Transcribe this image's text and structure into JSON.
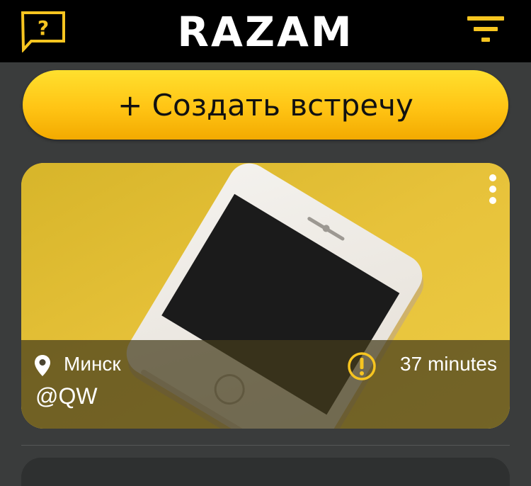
{
  "header": {
    "logo": "RAZAM",
    "help_icon": "question-speech-bubble-icon",
    "filter_icon": "filter-funnel-lines-icon",
    "accent_color": "#f7c520"
  },
  "actions": {
    "create_meeting_label": "+ Создать встречу"
  },
  "feed": {
    "cards": [
      {
        "city": "Минск",
        "handle": "@QW",
        "time": "37 minutes",
        "icons": [
          "location-pin-icon",
          "warning-icon",
          "more-vertical-icon"
        ]
      }
    ]
  }
}
